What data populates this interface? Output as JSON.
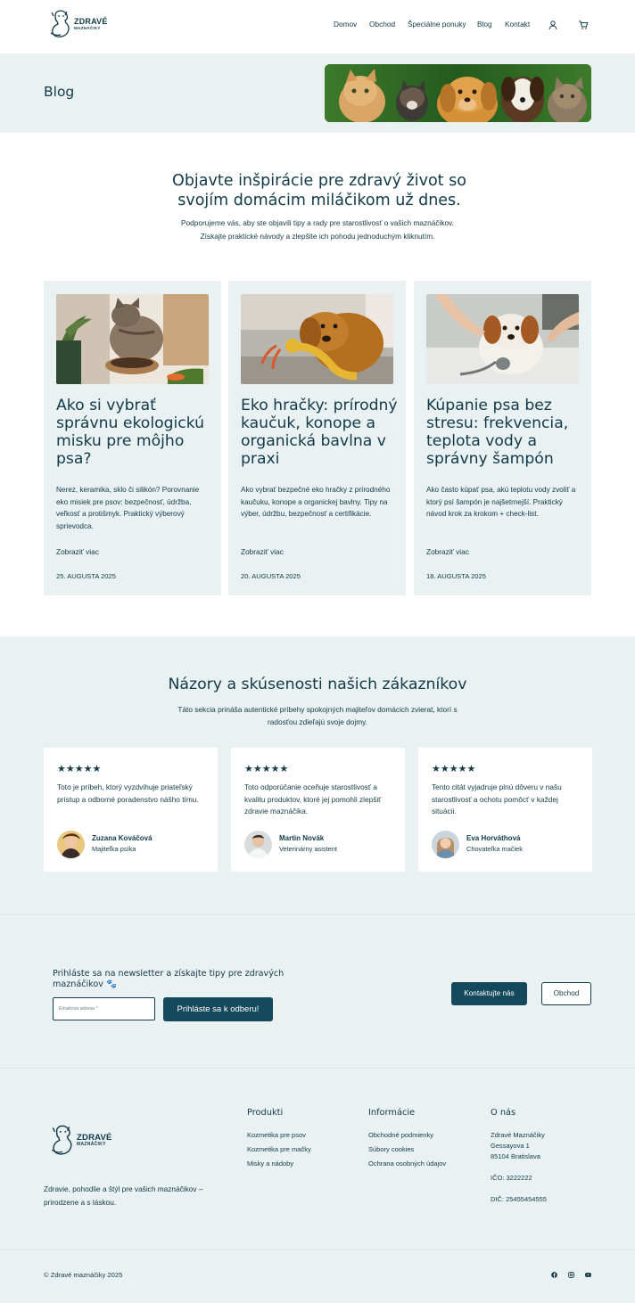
{
  "brand": {
    "name_line1": "ZDRAVÉ",
    "name_line2": "MAZNÁČIKY"
  },
  "nav": {
    "items": [
      "Domov",
      "Obchod",
      "Špeciálne ponuky",
      "Blog",
      "Kontakt"
    ],
    "account_icon": "user-icon",
    "cart_icon": "cart-icon"
  },
  "hero": {
    "title": "Blog"
  },
  "intro": {
    "heading": "Objavte inšpirácie pre zdravý život so svojím domácim miláčikom už dnes.",
    "text": "Podporujeme vás, aby ste objavili tipy a rady pre starostlivosť o vašich maznáčikov. Získajte praktické návody a zlepšite ich pohodu jednoduchým kliknutím."
  },
  "posts": [
    {
      "title": "Ako si vybrať správnu ekologickú misku pre môjho psa?",
      "excerpt": "Nerez, keramika, sklo či silikón? Porovnanie eko misiek pre psov: bezpečnosť, údržba, veľkosť a protišmyk. Praktický výberový sprievodca.",
      "more": "Zobraziť viac",
      "date": "25. AUGUSTA 2025"
    },
    {
      "title": "Eko hračky: prírodný kaučuk, konope a organická bavlna v praxi",
      "excerpt": "Ako vybrať bezpečné eko hračky z prírodného kaučuku, konope a organickej bavlny. Tipy na výber, údržbu, bezpečnosť a certifikácie.",
      "more": "Zobraziť viac",
      "date": "20. AUGUSTA 2025"
    },
    {
      "title": "Kúpanie psa bez stresu: frekvencia, teplota vody a správny šampón",
      "excerpt": "Ako často kúpať psa, akú teplotu vody zvoliť a ktorý psí šampón je najšetrnejší. Praktický návod krok za krokom + check-list.",
      "more": "Zobraziť viac",
      "date": "18. AUGUSTA 2025"
    }
  ],
  "testimonials": {
    "heading": "Názory a skúsenosti našich zákazníkov",
    "text": "Táto sekcia prináša autentické príbehy spokojných majiteľov domácich zvierat, ktorí s radosťou zdieľajú svoje dojmy.",
    "items": [
      {
        "rating": 5,
        "stars": "★★★★★",
        "quote": "Toto je príbeh, ktorý vyzdvihuje priateľský prístup a odborné poradenstvo nášho tímu.",
        "name": "Zuzana Kováčová",
        "role": "Majiteľka psíka"
      },
      {
        "rating": 5,
        "stars": "★★★★★",
        "quote": "Toto odporúčanie oceňuje starostlivosť a kvalitu produktov, ktoré jej pomohli zlepšiť zdravie maznáčika.",
        "name": "Martin Novák",
        "role": "Veterinárny asistent"
      },
      {
        "rating": 5,
        "stars": "★★★★★",
        "quote": "Tento citát vyjadruje plnú dôveru v našu starostlivosť a ochotu pomôcť v každej situácii.",
        "name": "Eva Horváthová",
        "role": "Chovateľka mačiek"
      }
    ]
  },
  "newsletter": {
    "heading": "Prihláste sa na newsletter a získajte tipy pre zdravých maznáčikov 🐾",
    "email_placeholder": "Emailová adresa *",
    "subscribe_label": "Prihláste sa k odberu!",
    "contact_label": "Kontaktujte nás",
    "shop_label": "Obchod"
  },
  "footer": {
    "tagline": "Zdravie, pohodlie a štýl pre vašich maznáčikov – prirodzene a s láskou.",
    "products": {
      "heading": "Produkti",
      "links": [
        "Kozmetika pre psov",
        "Kozmetika pre mačky",
        "Misky a nádoby"
      ]
    },
    "info": {
      "heading": "Informácie",
      "links": [
        "Obchodné podmienky",
        "Súbory cookies",
        "Ochrana osobných údajov"
      ]
    },
    "about": {
      "heading": "O nás",
      "lines": [
        "Zdravé Maznáčiky",
        "Gessayova 1",
        "85104 Bratislava",
        "IČO: 3222222",
        "DIČ: 25455454555"
      ]
    },
    "copyright": "© Zdravé maznáčiky 2025",
    "social_icons": [
      "facebook-icon",
      "instagram-icon",
      "youtube-icon"
    ]
  },
  "colors": {
    "primary": "#14495b",
    "text": "#123a48",
    "light_bg": "#e9f1f2",
    "white": "#ffffff"
  }
}
